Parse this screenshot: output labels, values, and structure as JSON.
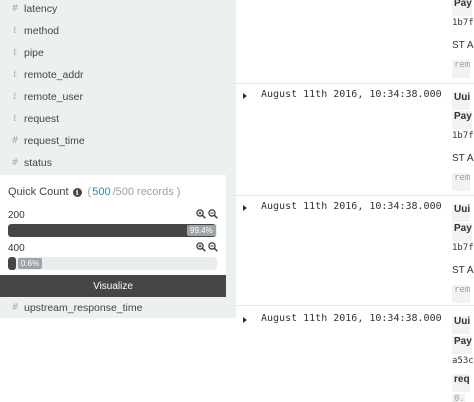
{
  "sidebar": {
    "fields": [
      {
        "type": "#",
        "name": "latency"
      },
      {
        "type": "t",
        "name": "method"
      },
      {
        "type": "t",
        "name": "pipe"
      },
      {
        "type": "t",
        "name": "remote_addr"
      },
      {
        "type": "t",
        "name": "remote_user"
      },
      {
        "type": "t",
        "name": "request"
      },
      {
        "type": "#",
        "name": "request_time"
      },
      {
        "type": "#",
        "name": "status"
      }
    ],
    "details": {
      "title": "Quick Count",
      "info_icon": "i",
      "paren_open": "(",
      "count": "500",
      "total": "/500 records",
      "paren_close": ")",
      "values": [
        {
          "label": "200",
          "percent_text": "99.4%",
          "fraction": 0.994
        },
        {
          "label": "400",
          "percent_text": "0.6%",
          "fraction": 0.006
        }
      ],
      "visualize_label": "Visualize"
    },
    "after_field": {
      "type": "#",
      "name": "upstream_response_time"
    }
  },
  "documents": [
    {
      "timestamp": "",
      "lines": [
        "Pay",
        "1b7f",
        "ST A",
        "rem"
      ]
    },
    {
      "timestamp": "August 11th 2016, 10:34:38.000",
      "lines": [
        "Uui",
        "Pay",
        "1b7f",
        "ST A",
        "rem"
      ]
    },
    {
      "timestamp": "August 11th 2016, 10:34:38.000",
      "lines": [
        "Uui",
        "Pay",
        "1b7f",
        "ST A",
        "rem"
      ]
    },
    {
      "timestamp": "August 11th 2016, 10:34:38.000",
      "lines": [
        "Uui",
        "Pay",
        "a53c",
        "req",
        "0."
      ]
    }
  ],
  "icons": {
    "zoom_in": "magnifier-plus-icon",
    "zoom_out": "magnifier-minus-icon",
    "expand": "caret-right-icon"
  },
  "colors": {
    "sidebar_bg": "#ecf0f1",
    "bar_fill": "#464646",
    "link": "#2c87c6"
  }
}
